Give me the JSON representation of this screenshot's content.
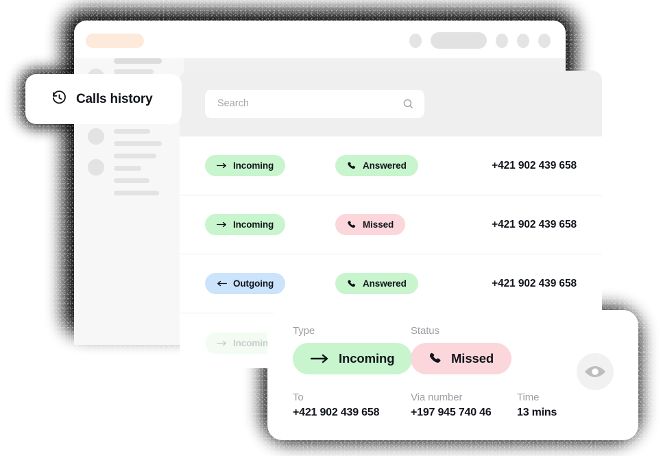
{
  "window": {
    "url_pill": "",
    "chrome_controls": [
      "circle",
      "pill",
      "circle",
      "circle",
      "circle"
    ]
  },
  "history_card": {
    "title": "Calls history",
    "icon": "history-clock-icon"
  },
  "search": {
    "placeholder": "Search",
    "value": "",
    "icon": "search-icon"
  },
  "table": {
    "rows": [
      {
        "type": "Incoming",
        "type_color": "#c8f5cd",
        "type_icon": "arrow-right-icon",
        "status": "Answered",
        "status_color": "#c8f5cd",
        "status_icon": "phone-icon",
        "number": "+421 902 439 658"
      },
      {
        "type": "Incoming",
        "type_color": "#c8f5cd",
        "type_icon": "arrow-right-icon",
        "status": "Missed",
        "status_color": "#fbd7dc",
        "status_icon": "phone-icon",
        "number": "+421 902 439 658"
      },
      {
        "type": "Outgoing",
        "type_color": "#cbe3fb",
        "type_icon": "arrow-left-icon",
        "status": "Answered",
        "status_color": "#c8f5cd",
        "status_icon": "phone-icon",
        "number": "+421 902 439 658"
      },
      {
        "type": "Incoming",
        "type_color": "#c8f5cd",
        "type_icon": "arrow-right-icon",
        "status": "",
        "status_color": "#c8f5cd",
        "status_icon": "phone-icon",
        "number": ""
      }
    ]
  },
  "detail": {
    "type_label": "Type",
    "type_value": "Incoming",
    "type_color": "#c8f5cd",
    "type_icon": "arrow-right-icon",
    "status_label": "Status",
    "status_value": "Missed",
    "status_color": "#fbd7dc",
    "status_icon": "phone-icon",
    "to_label": "To",
    "to_value": "+421 902 439 658",
    "via_label": "Via number",
    "via_value": "+197 945 740 46",
    "time_label": "Time",
    "time_value": "13 mins",
    "eye_icon": "eye-icon"
  },
  "colors": {
    "green": "#c8f5cd",
    "pink": "#fbd7dc",
    "blue": "#cbe3fb",
    "accent_peach": "#fdeada",
    "text": "#11141a",
    "muted": "#9b9ea3"
  }
}
